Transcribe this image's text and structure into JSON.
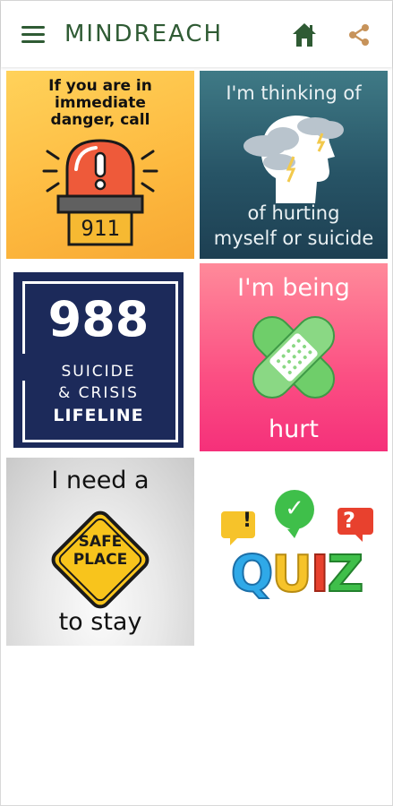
{
  "app": {
    "title": "MINDREACH",
    "brand_color": "#2f5b34",
    "share_color": "#c7935a"
  },
  "icons": {
    "menu": "menu-icon",
    "home": "home-icon",
    "share": "share-icon"
  },
  "tiles": [
    {
      "id": "danger",
      "lines": [
        "If you are in",
        "immediate",
        "danger, call"
      ],
      "badge": "911"
    },
    {
      "id": "hurting",
      "top": "I'm thinking of",
      "bottom": [
        "of hurting",
        "myself or suicide"
      ]
    },
    {
      "id": "lifeline",
      "number": "988",
      "lines": [
        "SUICIDE",
        "& CRISIS",
        "LIFELINE"
      ]
    },
    {
      "id": "being-hurt",
      "top": "I'm being",
      "bottom": "hurt"
    },
    {
      "id": "safe-place",
      "top": "I need a",
      "sign": [
        "SAFE",
        "PLACE"
      ],
      "bottom": "to stay"
    },
    {
      "id": "quiz",
      "word": "QUIZ",
      "letters": [
        "Q",
        "U",
        "I",
        "Z"
      ],
      "marks": [
        "!",
        "✓",
        "?"
      ]
    }
  ]
}
